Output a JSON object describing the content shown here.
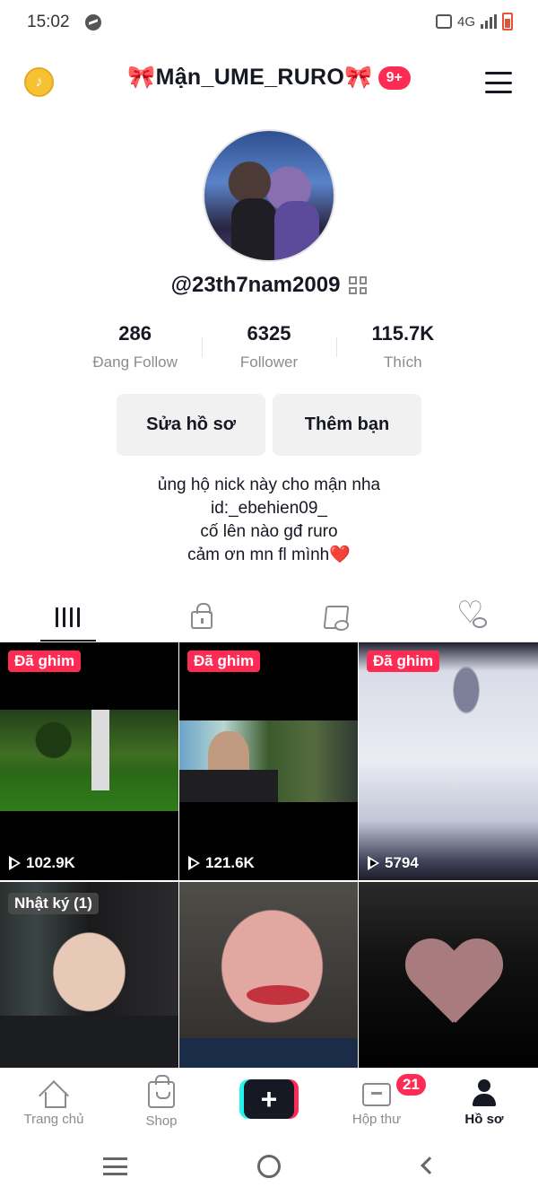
{
  "status_bar": {
    "time": "15:02",
    "network": "4G"
  },
  "header": {
    "coin_symbol": "♪",
    "title": "🎀Mận_UME_RURO🎀",
    "notification_badge": "9+"
  },
  "profile": {
    "handle": "@23th7nam2009",
    "stats": [
      {
        "value": "286",
        "label": "Đang Follow"
      },
      {
        "value": "6325",
        "label": "Follower"
      },
      {
        "value": "115.7K",
        "label": "Thích"
      }
    ],
    "buttons": {
      "edit": "Sửa hồ sơ",
      "add_friend": "Thêm bạn"
    },
    "bio": [
      "ủng hộ nick này cho mận nha",
      "id:_ebehien09_",
      "cố lên nào gđ ruro",
      "cảm ơn mn fl mình❤️"
    ]
  },
  "tabs": [
    {
      "name": "videos",
      "icon": "grid-icon",
      "active": true
    },
    {
      "name": "private",
      "icon": "lock-icon",
      "active": false
    },
    {
      "name": "saved",
      "icon": "bookmark-hidden-icon",
      "active": false
    },
    {
      "name": "liked",
      "icon": "heart-hidden-icon",
      "active": false
    }
  ],
  "videos": [
    {
      "tag": "Đã ghim",
      "views": "102.9K"
    },
    {
      "tag": "Đã ghim",
      "views": "121.6K"
    },
    {
      "tag": "Đã ghim",
      "views": "5794"
    },
    {
      "tag": "Nhật ký (1)",
      "views": ""
    },
    {
      "tag": "",
      "views": ""
    },
    {
      "tag": "",
      "views": ""
    }
  ],
  "bottom_nav": [
    {
      "label": "Trang chủ",
      "icon": "home-icon"
    },
    {
      "label": "Shop",
      "icon": "shop-icon"
    },
    {
      "label": "",
      "icon": "create-icon",
      "symbol": "+"
    },
    {
      "label": "Hộp thư",
      "icon": "inbox-icon",
      "badge": "21"
    },
    {
      "label": "Hồ sơ",
      "icon": "profile-icon",
      "active": true
    }
  ],
  "colors": {
    "accent": "#fe2c55",
    "text": "#161823",
    "muted": "#8a8b91",
    "button_bg": "#f1f1f2"
  }
}
